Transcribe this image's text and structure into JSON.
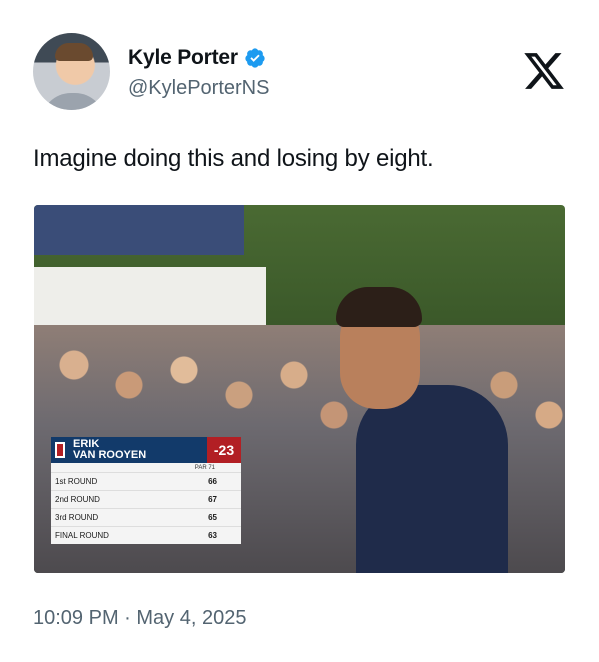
{
  "author": {
    "name": "Kyle Porter",
    "handle": "@KylePorterNS",
    "verified": true,
    "verified_color": "#1d9bf0",
    "avatar_icon": "profile-photo"
  },
  "brand_icon": "x-logo-icon",
  "tweet": {
    "text": "Imagine doing this and losing by eight."
  },
  "media": {
    "scorebug": {
      "first_name": "ERIK",
      "last_name": "VAN ROOYEN",
      "score": "-23",
      "par_label": "PAR 71",
      "rounds": [
        {
          "label": "1st ROUND",
          "score": "66"
        },
        {
          "label": "2nd ROUND",
          "score": "67"
        },
        {
          "label": "3rd ROUND",
          "score": "65"
        },
        {
          "label": "FINAL ROUND",
          "score": "63"
        }
      ],
      "colors": {
        "header": "#123a6a",
        "score_bg": "#b21f24"
      }
    }
  },
  "timestamp": "10:09 PM · May 4, 2025"
}
